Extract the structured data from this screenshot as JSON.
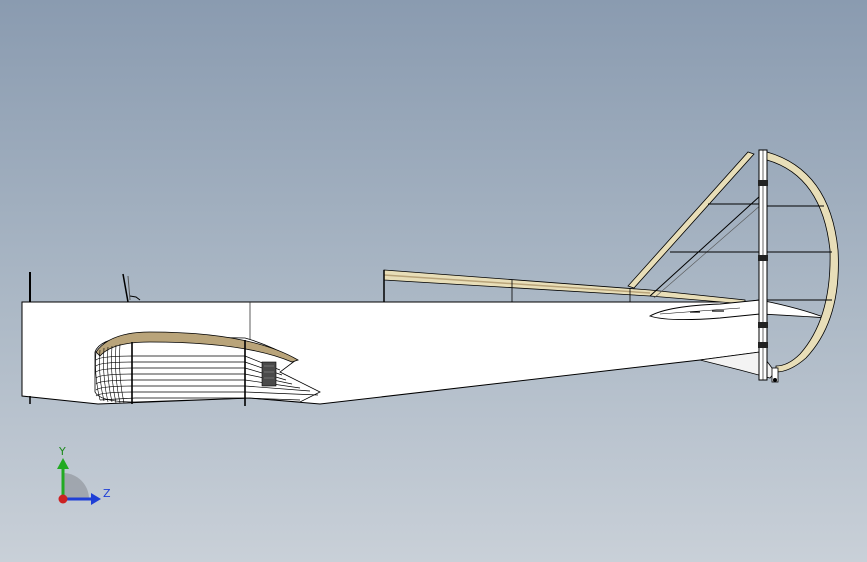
{
  "viewport": {
    "background_top": "#8a9bb0",
    "background_bottom": "#c9d0d8",
    "model_name": "",
    "view_orientation": "right-side"
  },
  "model": {
    "fuselage_fill": "#ffffff",
    "edge_color": "#000000",
    "wood_color": "#c8b68a",
    "wood_light_color": "#e8deb8",
    "components": [
      "fuselage",
      "engine-cowling-ribs",
      "cockpit-struts",
      "horizontal-stabilizer",
      "vertical-fin",
      "rudder",
      "tail-skid"
    ]
  },
  "triad": {
    "y_label": "Y",
    "z_label": "Z",
    "y_color": "#22aa22",
    "z_color": "#1f3fd6",
    "x_color": "#cc2222"
  }
}
